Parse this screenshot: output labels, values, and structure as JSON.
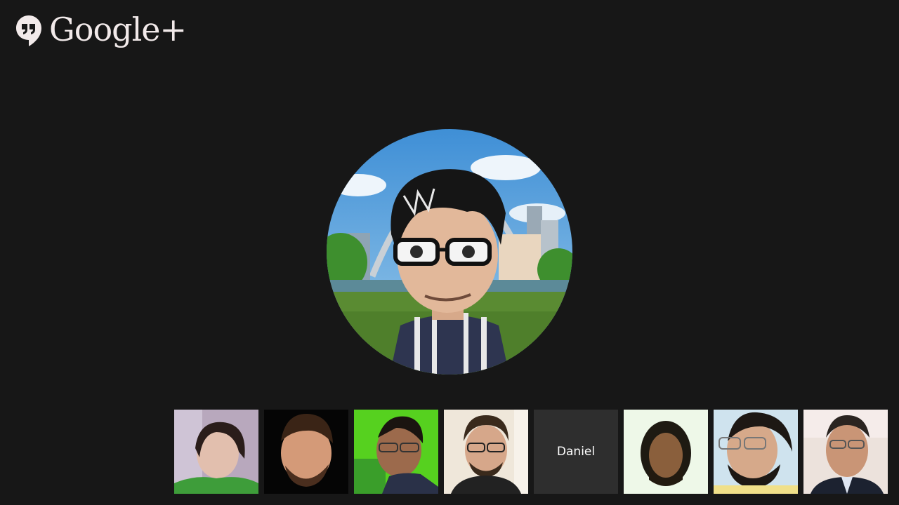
{
  "brand": {
    "name": "Google+",
    "icon": "hangouts-quote-icon",
    "accent_color": "#f2eaea"
  },
  "main_speaker": {
    "kind": "cartoon avatar video"
  },
  "participants": [
    {
      "kind": "video"
    },
    {
      "kind": "video"
    },
    {
      "kind": "video"
    },
    {
      "kind": "video"
    },
    {
      "kind": "name",
      "label": "Daniel"
    },
    {
      "kind": "video"
    },
    {
      "kind": "video"
    },
    {
      "kind": "video"
    }
  ],
  "colors": {
    "background": "#171717",
    "name_tile": "#2e2e2e"
  }
}
